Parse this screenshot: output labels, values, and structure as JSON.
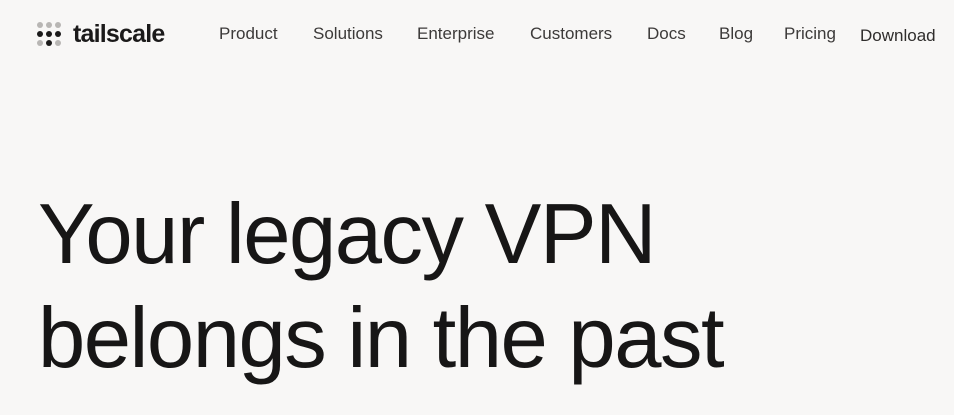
{
  "brand": {
    "name": "tailscale",
    "logo_icon": "tailscale-dot-grid-logo"
  },
  "nav": {
    "items": [
      {
        "label": "Product"
      },
      {
        "label": "Solutions"
      },
      {
        "label": "Enterprise"
      },
      {
        "label": "Customers"
      },
      {
        "label": "Docs"
      },
      {
        "label": "Blog"
      },
      {
        "label": "Pricing"
      }
    ],
    "download_label": "Download"
  },
  "hero": {
    "title_line_1": "Your legacy VPN",
    "title_line_2": "belongs in the past"
  },
  "colors": {
    "background": "#f8f7f6",
    "text": "#1b1a1a",
    "logo_dot_faded": "#b8b6b4"
  }
}
